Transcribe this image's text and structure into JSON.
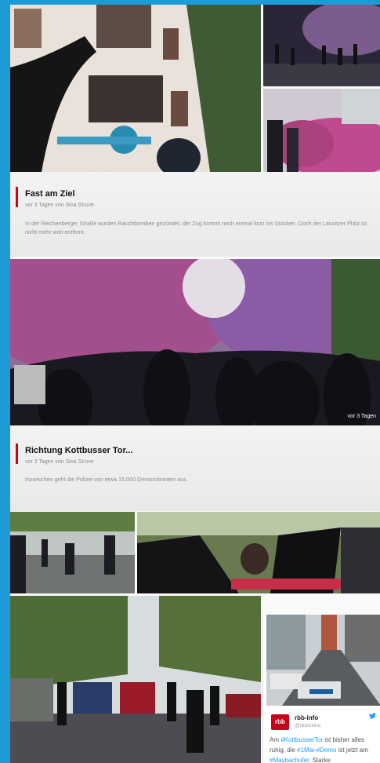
{
  "posts": [
    {
      "title": "Fast am Ziel",
      "meta": "vor 3 Tagen von Sina Struve",
      "body": "In der Reichenberger Straße wurden Rauchbomben gezündet, der Zug kommt noch einmal kurz ins Stocken. Doch der Lausitzer Platz ist nicht mehr weit entfernt."
    },
    {
      "title": "Richtung Kottbusser Tor...",
      "meta": "vor 3 Tagen von Sina Struve",
      "body": "Inzwischen geht die Polizei von etwa 15.000 Demonstranten aus."
    }
  ],
  "photo_overlay": {
    "timestamp": "vor 3 Tagen"
  },
  "tweet": {
    "logo": "rbb",
    "name": "rbb-info",
    "handle": "@rbbonline",
    "text_pre1": "Am ",
    "hashtag1": "#KottbusserTor",
    "text_pre2": " ist bisher alles ruhig, die ",
    "hashtag2": "#1Mai",
    "text_pre3": "-",
    "hashtag3": "#Demo",
    "text_pre4": " ist jetzt am ",
    "hashtag4": "#Maybachufer",
    "text_post": ". Starke",
    "icon": "twitter-bird-icon"
  },
  "colors": {
    "frame": "#1e9bd7",
    "accent": "#d0021b",
    "hashtag": "#1da1f2"
  }
}
